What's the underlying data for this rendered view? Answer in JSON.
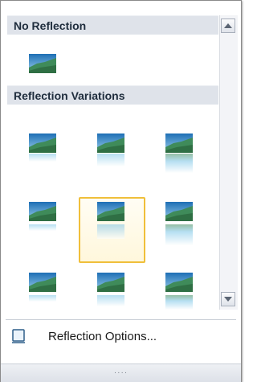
{
  "sections": {
    "no_reflection": "No Reflection",
    "variations": "Reflection Variations"
  },
  "options": {
    "label": "Reflection Options..."
  },
  "icons": {
    "scroll_up": "triangle-up-icon",
    "scroll_down": "triangle-down-icon",
    "options": "monitor-icon",
    "grip": "resize-grip-icon"
  },
  "selected_variation": 5,
  "colors": {
    "header_bg": "#dfe3ea",
    "selection": "#f0bf3a",
    "text": "#1a1a1a"
  }
}
